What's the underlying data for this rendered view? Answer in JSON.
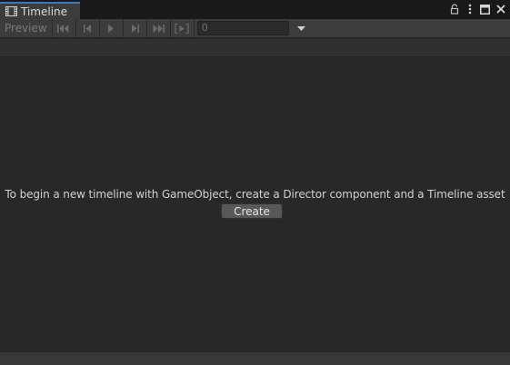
{
  "window": {
    "tab_title": "Timeline",
    "tab_icon": "film-icon",
    "accent_color": "#3a79bb"
  },
  "toolbar": {
    "preview_label": "Preview",
    "buttons": [
      {
        "icon": "goto-start-icon"
      },
      {
        "icon": "previous-frame-icon"
      },
      {
        "icon": "play-icon"
      },
      {
        "icon": "next-frame-icon"
      },
      {
        "icon": "goto-end-icon"
      },
      {
        "icon": "play-range-icon"
      }
    ],
    "time_value": "0",
    "dropdown_icon": "chevron-down-icon"
  },
  "window_controls": {
    "lock_icon": "lock-icon",
    "menu_icon": "more-vertical-icon",
    "maximize_icon": "maximize-icon",
    "close_icon": "close-icon"
  },
  "main": {
    "message": "To begin a new timeline with GameObject, create a Director component and a Timeline asset",
    "create_label": "Create"
  }
}
